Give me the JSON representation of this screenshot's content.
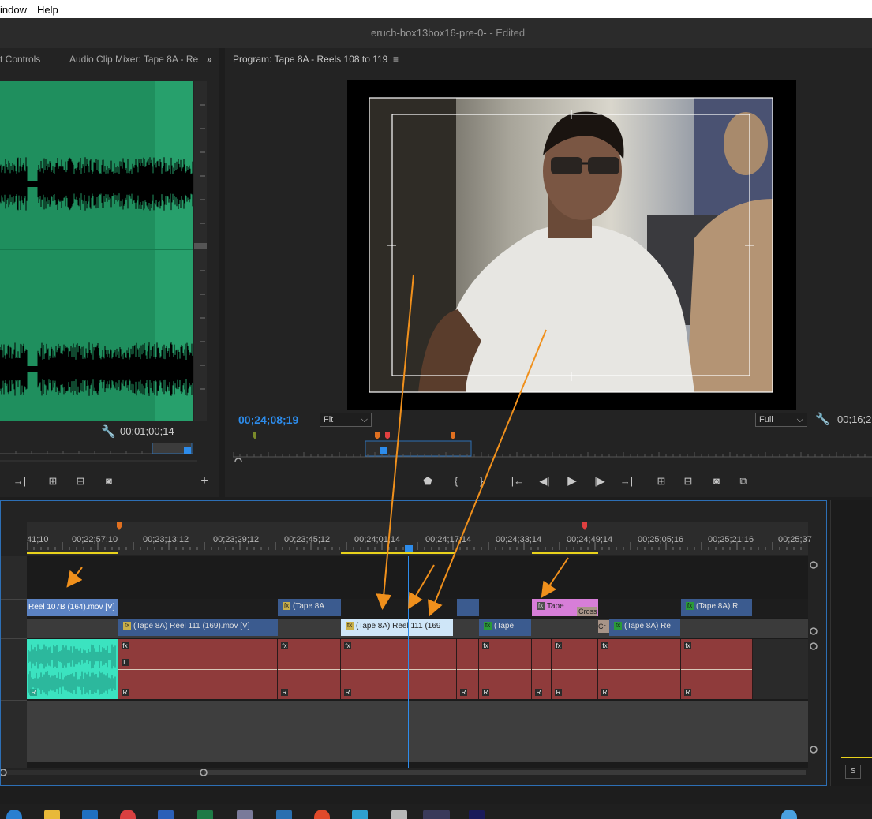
{
  "menubar": {
    "window_label": "indow",
    "help_label": "Help"
  },
  "titlebar": {
    "title": "eruch-box13box16-pre-0-",
    "edited": " - Edited"
  },
  "source_panel": {
    "tab_effect_controls": "t Controls",
    "tab_audio_mixer": "Audio Clip Mixer: Tape 8A - Re",
    "overflow_label": "»",
    "timecode": "00;01;00;14",
    "accent_color": "#1f8f5e"
  },
  "program_panel": {
    "title": "Program: Tape 8A - Reels 108 to 119",
    "timecode": "00;24;08;19",
    "zoom_select": "Fit",
    "quality_select": "Full",
    "timecode_right": "00;16;2"
  },
  "timeline": {
    "ruler_labels": [
      "41;10",
      "00;22;57;10",
      "00;23;13;12",
      "00;23;29;12",
      "00;23;45;12",
      "00;24;01;14",
      "00;24;17;14",
      "00;24;33;14",
      "00;24;49;14",
      "00;25;05;16",
      "00;25;21;16",
      "00;25;37"
    ],
    "video_clips_v2": [
      {
        "label": "Reel 107B (164).mov [V]"
      },
      {
        "label": "(Tape 8A"
      },
      {
        "label": "Tape"
      },
      {
        "label": "Cross"
      },
      {
        "label": "(Tape 8A) R"
      }
    ],
    "video_clips_v1": [
      {
        "label": "(Tape 8A) Reel 111 (169).mov [V]"
      },
      {
        "label": "(Tape 8A) Reel 111 (169"
      },
      {
        "label": "(Tape"
      },
      {
        "label": "Cr"
      },
      {
        "label": "(Tape 8A) Re"
      }
    ],
    "audio_channel_labels": {
      "left": "L",
      "right": "R"
    }
  },
  "right_panel": {
    "s_label": "S"
  },
  "colors": {
    "playhead": "#2d8ceb",
    "selection": "#2d6fb5",
    "audio_clip": "#8f3b3b",
    "video_clip": "#3b5b8f",
    "annotation_arrow": "#f0901c"
  }
}
